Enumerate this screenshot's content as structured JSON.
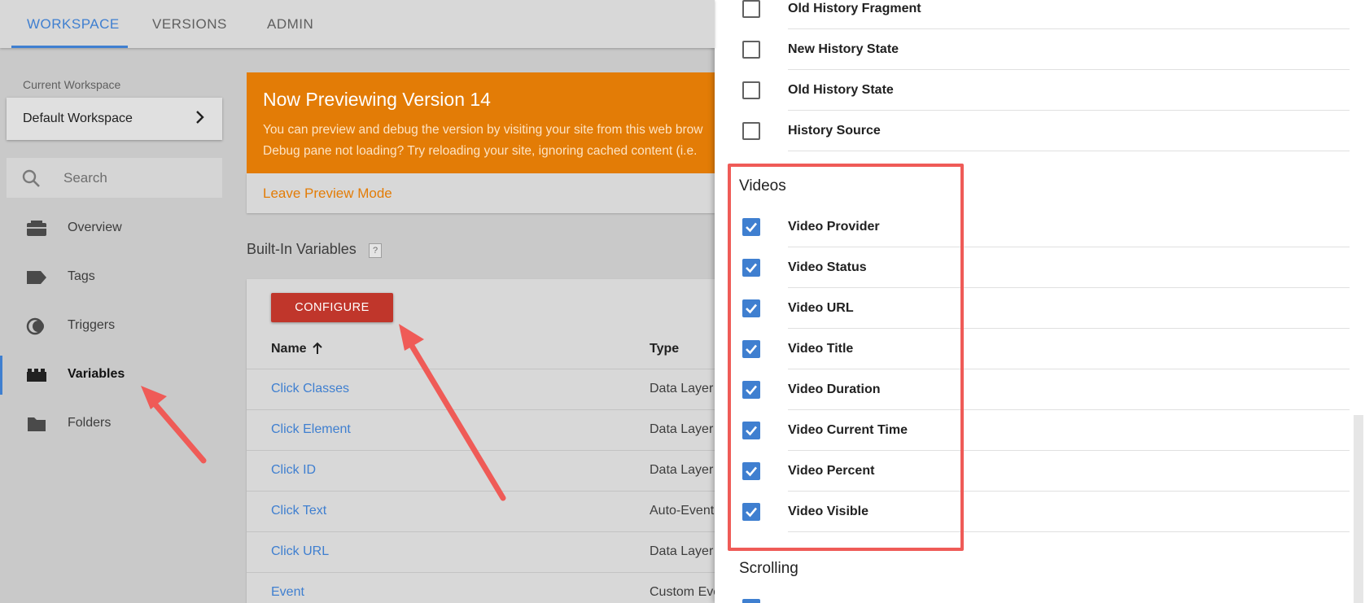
{
  "tabs": [
    {
      "label": "WORKSPACE",
      "active": true
    },
    {
      "label": "VERSIONS",
      "active": false
    },
    {
      "label": "ADMIN",
      "active": false
    }
  ],
  "sidebar": {
    "workspace_label": "Current Workspace",
    "workspace_name": "Default Workspace",
    "search_placeholder": "Search",
    "items": [
      {
        "label": "Overview",
        "icon": "briefcase-icon"
      },
      {
        "label": "Tags",
        "icon": "tag-icon"
      },
      {
        "label": "Triggers",
        "icon": "trigger-icon"
      },
      {
        "label": "Variables",
        "icon": "variables-icon",
        "active": true
      },
      {
        "label": "Folders",
        "icon": "folder-icon"
      }
    ]
  },
  "banner": {
    "title": "Now Previewing Version 14",
    "line1": "You can preview and debug the version by visiting your site from this web brow",
    "line2": "Debug pane not loading? Try reloading your site, ignoring cached content (i.e.",
    "leave_label": "Leave Preview Mode"
  },
  "builtin": {
    "title": "Built-In Variables",
    "help": "?",
    "configure_label": "CONFIGURE",
    "columns": {
      "name": "Name",
      "type": "Type"
    },
    "rows": [
      {
        "name": "Click Classes",
        "type": "Data Layer"
      },
      {
        "name": "Click Element",
        "type": "Data Layer"
      },
      {
        "name": "Click ID",
        "type": "Data Layer"
      },
      {
        "name": "Click Text",
        "type": "Auto-Event"
      },
      {
        "name": "Click URL",
        "type": "Data Layer"
      },
      {
        "name": "Event",
        "type": "Custom Eve"
      }
    ]
  },
  "panel": {
    "history": [
      {
        "label": "Old History Fragment",
        "checked": false
      },
      {
        "label": "New History State",
        "checked": false
      },
      {
        "label": "Old History State",
        "checked": false
      },
      {
        "label": "History Source",
        "checked": false
      }
    ],
    "videos_title": "Videos",
    "videos": [
      {
        "label": "Video Provider",
        "checked": true
      },
      {
        "label": "Video Status",
        "checked": true
      },
      {
        "label": "Video URL",
        "checked": true
      },
      {
        "label": "Video Title",
        "checked": true
      },
      {
        "label": "Video Duration",
        "checked": true
      },
      {
        "label": "Video Current Time",
        "checked": true
      },
      {
        "label": "Video Percent",
        "checked": true
      },
      {
        "label": "Video Visible",
        "checked": true
      }
    ],
    "scrolling_title": "Scrolling"
  },
  "colors": {
    "accent": "#3f7fd0",
    "banner": "#e37c06",
    "configure": "#c0362b",
    "annotation": "#ef5b57"
  }
}
